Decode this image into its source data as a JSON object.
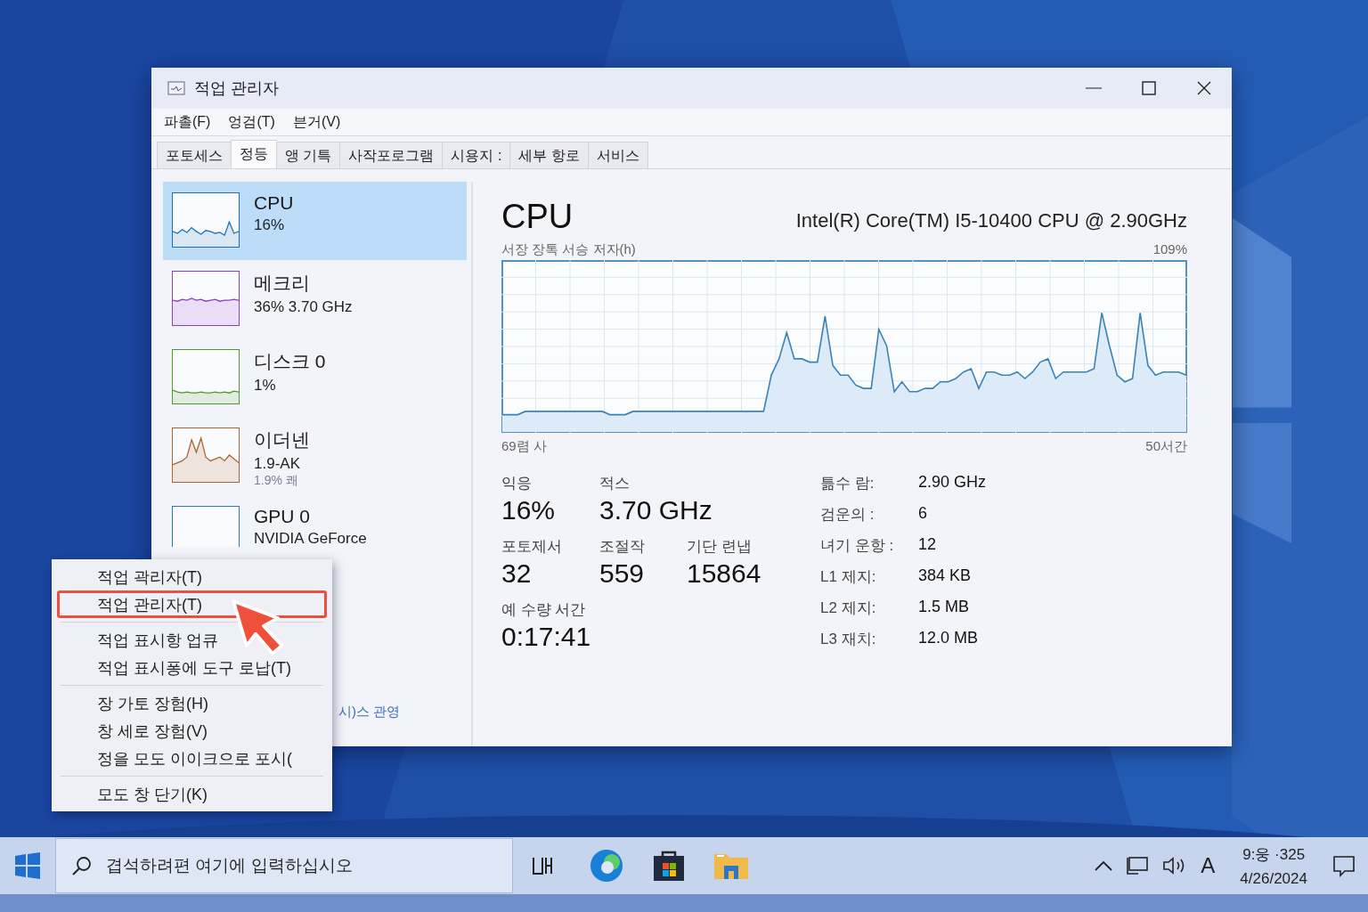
{
  "window": {
    "title": "적업 관리자"
  },
  "menu_bar": [
    "파촐(F)",
    "엉검(T)",
    "븐거(V)"
  ],
  "tabs": [
    {
      "label": "포토세스",
      "selected": false
    },
    {
      "label": "정등",
      "selected": true
    },
    {
      "label": "앵 기특",
      "selected": false
    },
    {
      "label": "사작포로그램",
      "selected": false
    },
    {
      "label": "시용지 :",
      "selected": false
    },
    {
      "label": "세부 항로",
      "selected": false
    },
    {
      "label": "서비스",
      "selected": false
    }
  ],
  "sidebar": {
    "items": [
      {
        "name": "CPU",
        "detail": "16%",
        "color": "#1f6fb4",
        "selected": true
      },
      {
        "name": "메크리",
        "detail": "36%  3.70 GHz",
        "color": "#8b3fc4",
        "selected": false
      },
      {
        "name": "디스크 0",
        "detail": "1%",
        "color": "#4d9a2a",
        "selected": false
      },
      {
        "name": "이더넨",
        "detail": "1.9-AK",
        "note": "1.9% 쾌",
        "color": "#a8642a",
        "selected": false
      },
      {
        "name": "GPU 0",
        "detail": "NVIDIA GeForce",
        "color": "#2a7ab8",
        "selected": false
      }
    ],
    "footer_link": "시)스 관영"
  },
  "detail": {
    "title": "CPU",
    "model": "Intel(R) Core(TM) I5-10400 CPU @ 2.90GHz",
    "graph_label": "서장 장톡 서승 저자(h)",
    "graph_max": "109%",
    "graph_start": "69렴 사",
    "graph_end": "50서간",
    "stat_rows": [
      [
        {
          "label": "익응",
          "value": "16%"
        },
        {
          "label": "적스",
          "value": "3.70 GHz"
        }
      ],
      [
        {
          "label": "포토제서",
          "value": "32"
        },
        {
          "label": "조절작",
          "value": "559"
        },
        {
          "label": "기단 련냅",
          "value": "15864"
        }
      ],
      [
        {
          "label": "예 수량 서간",
          "value": "0:17:41"
        }
      ]
    ],
    "specs": [
      {
        "label": "틂수 람:",
        "value": "2.90 GHz"
      },
      {
        "label": "검운의 :",
        "value": "6"
      },
      {
        "label": "녀기 운항 :",
        "value": "12"
      },
      {
        "label": "L1 제지:",
        "value": "384 KB"
      },
      {
        "label": "L2 제지:",
        "value": "1.5 MB"
      },
      {
        "label": "L3 재치:",
        "value": "12.0 MB"
      }
    ]
  },
  "context_menu": {
    "groups": [
      [
        {
          "label": "적업 곽리자(T)",
          "selected": false
        },
        {
          "label": "적업 관리자(T)",
          "selected": true
        }
      ],
      [
        {
          "label": "적업 표시항 업큐",
          "selected": false
        },
        {
          "label": "적업 표시퐁에 도구 로납(T)",
          "selected": false
        }
      ],
      [
        {
          "label": "장 가토 장험(H)",
          "selected": false
        },
        {
          "label": "창 세로 장험(V)",
          "selected": false
        },
        {
          "label": "정을 모도 이이크으로 포시(",
          "selected": false
        }
      ],
      [
        {
          "label": "모도 창 단기(K)",
          "selected": false
        }
      ]
    ]
  },
  "taskbar": {
    "search_placeholder": "겹석하려편 여기에 입력하십시오",
    "input_indicator": "A",
    "clock_time": "9:웅 ·325",
    "clock_date": "4/26/2024"
  }
}
